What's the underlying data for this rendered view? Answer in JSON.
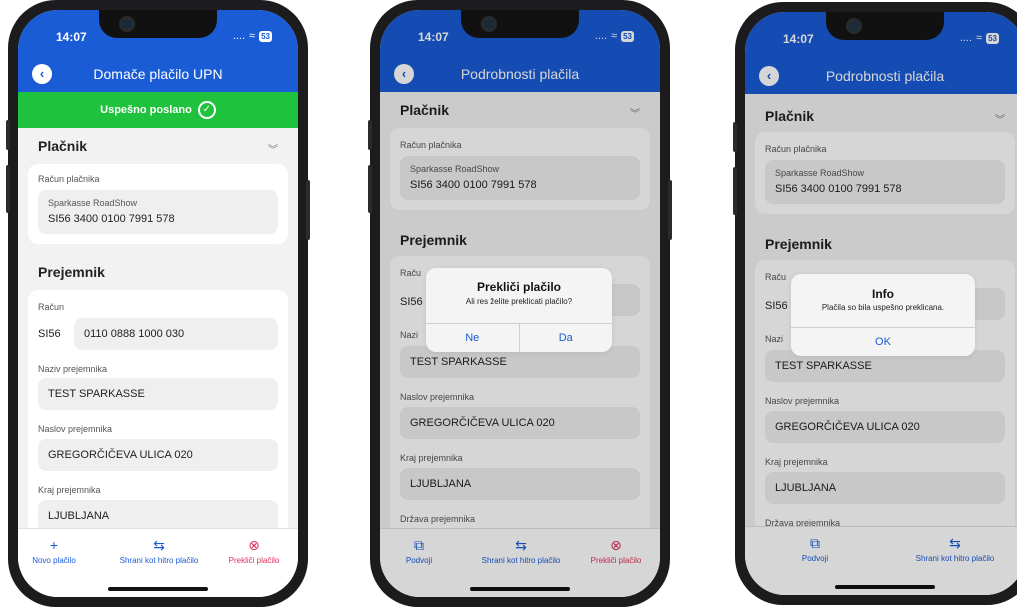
{
  "status": {
    "time": "14:07",
    "signal": "....",
    "wifi": "≈",
    "battery": "53"
  },
  "screen1": {
    "title": "Domače plačilo UPN",
    "banner": "Uspešno poslano",
    "payer": {
      "section": "Plačnik",
      "account_label": "Račun plačnika",
      "bank": "Sparkasse RoadShow",
      "iban": "SI56 3400 0100 7991 578"
    },
    "recipient": {
      "section": "Prejemnik",
      "account_label": "Račun",
      "prefix": "SI56",
      "account": "0110 0888 1000 030",
      "name_label": "Naziv prejemnika",
      "name": "TEST SPARKASSE",
      "address_label": "Naslov prejemnika",
      "address": "GREGORČIČEVA ULICA 020",
      "city_label": "Kraj prejemnika",
      "city": "LJUBLJANA"
    },
    "tabs": [
      "Novo plačilo",
      "Shrani kot hitro plačilo",
      "Prekliči plačilo"
    ]
  },
  "screen2": {
    "title": "Podrobnosti plačila",
    "payer": {
      "section": "Plačnik",
      "account_label": "Račun plačnika",
      "bank": "Sparkasse RoadShow",
      "iban": "SI56 3400 0100 7991 578"
    },
    "recipient": {
      "section": "Prejemnik",
      "account_label_partial": "Raču",
      "prefix": "SI56",
      "name_label_partial": "Nazi",
      "name": "TEST SPARKASSE",
      "address_label": "Naslov prejemnika",
      "address": "GREGORČIČEVA ULICA 020",
      "city_label": "Kraj prejemnika",
      "city": "LJUBLJANA",
      "country_label": "Država prejemnika"
    },
    "alert": {
      "title": "Prekliči plačilo",
      "message": "Ali res želite preklicati plačilo?",
      "no": "Ne",
      "yes": "Da"
    },
    "tabs": [
      "Podvoji",
      "Shrani kot hitro plačilo",
      "Prekliči plačilo"
    ]
  },
  "screen3": {
    "title": "Podrobnosti plačila",
    "payer": {
      "section": "Plačnik",
      "account_label": "Račun plačnika",
      "bank": "Sparkasse RoadShow",
      "iban": "SI56 3400 0100 7991 578"
    },
    "recipient": {
      "section": "Prejemnik",
      "account_label_partial": "Raču",
      "prefix": "SI56",
      "name_label_partial": "Nazi",
      "name": "TEST SPARKASSE",
      "address_label": "Naslov prejemnika",
      "address": "GREGORČIČEVA ULICA 020",
      "city_label": "Kraj prejemnika",
      "city": "LJUBLJANA",
      "country_label": "Država prejemnika"
    },
    "alert": {
      "title": "Info",
      "message": "Plačila so bila uspešno preklicana.",
      "ok": "OK"
    },
    "tabs": [
      "Podvoji",
      "Shrani kot hitro plačilo"
    ]
  },
  "icons": {
    "back": "back-arrow-icon",
    "check": "check-circle-icon",
    "chevron": "double-chevron-down-icon",
    "plus": "plus-icon",
    "swap": "swap-arrows-icon",
    "cancel": "cancel-circle-icon",
    "duplicate": "duplicate-icon"
  },
  "colors": {
    "brand": "#1a5bd6",
    "success": "#1ec23c",
    "danger": "#e0305a"
  }
}
